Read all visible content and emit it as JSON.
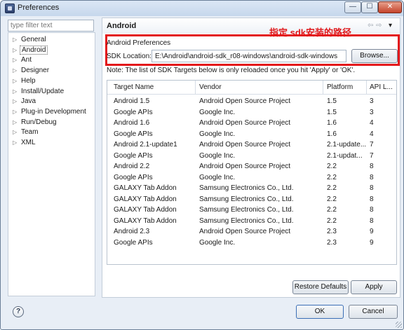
{
  "window": {
    "title": "Preferences",
    "minimize_glyph": "—",
    "maximize_glyph": "☐",
    "close_glyph": "✕"
  },
  "sidebar": {
    "filter_placeholder": "type filter text",
    "items": [
      {
        "label": "General",
        "arrow": "▷"
      },
      {
        "label": "Android",
        "arrow": "▷"
      },
      {
        "label": "Ant",
        "arrow": "▷"
      },
      {
        "label": "Designer",
        "arrow": "▷"
      },
      {
        "label": "Help",
        "arrow": "▷"
      },
      {
        "label": "Install/Update",
        "arrow": "▷"
      },
      {
        "label": "Java",
        "arrow": "▷"
      },
      {
        "label": "Plug-in Development",
        "arrow": "▷"
      },
      {
        "label": "Run/Debug",
        "arrow": "▷"
      },
      {
        "label": "Team",
        "arrow": "▷"
      },
      {
        "label": "XML",
        "arrow": "▷"
      }
    ],
    "selected": "Android"
  },
  "page": {
    "title": "Android",
    "nav_back": "⇦",
    "nav_fwd": "⇨",
    "nav_menu": "▾",
    "annotation": "指定 sdk安装的路径",
    "preferences_label": "Android Preferences",
    "sdk_location_label": "SDK Location:",
    "sdk_location_value": "E:\\Android\\android-sdk_r08-windows\\android-sdk-windows",
    "browse_label": "Browse...",
    "note": "Note: The list of SDK Targets below is only reloaded once you hit 'Apply' or 'OK'."
  },
  "targets": {
    "columns": [
      "Target Name",
      "Vendor",
      "Platform",
      "API L..."
    ],
    "rows": [
      [
        "Android 1.5",
        "Android Open Source Project",
        "1.5",
        "3"
      ],
      [
        "Google APIs",
        "Google Inc.",
        "1.5",
        "3"
      ],
      [
        "Android 1.6",
        "Android Open Source Project",
        "1.6",
        "4"
      ],
      [
        "Google APIs",
        "Google Inc.",
        "1.6",
        "4"
      ],
      [
        "Android 2.1-update1",
        "Android Open Source Project",
        "2.1-update...",
        "7"
      ],
      [
        "Google APIs",
        "Google Inc.",
        "2.1-updat...",
        "7"
      ],
      [
        "Android 2.2",
        "Android Open Source Project",
        "2.2",
        "8"
      ],
      [
        "Google APIs",
        "Google Inc.",
        "2.2",
        "8"
      ],
      [
        "GALAXY Tab Addon",
        "Samsung Electronics Co., Ltd.",
        "2.2",
        "8"
      ],
      [
        "GALAXY Tab Addon",
        "Samsung Electronics Co., Ltd.",
        "2.2",
        "8"
      ],
      [
        "GALAXY Tab Addon",
        "Samsung Electronics Co., Ltd.",
        "2.2",
        "8"
      ],
      [
        "GALAXY Tab Addon",
        "Samsung Electronics Co., Ltd.",
        "2.2",
        "8"
      ],
      [
        "Android 2.3",
        "Android Open Source Project",
        "2.3",
        "9"
      ],
      [
        "Google APIs",
        "Google Inc.",
        "2.3",
        "9"
      ]
    ]
  },
  "buttons": {
    "restore_defaults": "Restore Defaults",
    "apply": "Apply",
    "ok": "OK",
    "cancel": "Cancel",
    "help": "?"
  },
  "colors": {
    "annotation": "#e0191c",
    "highlight_box": "#e3181b"
  },
  "icons": [
    "app-icon",
    "help-icon",
    "back-arrow-icon",
    "forward-arrow-icon",
    "view-menu-icon",
    "resize-grip-icon"
  ]
}
